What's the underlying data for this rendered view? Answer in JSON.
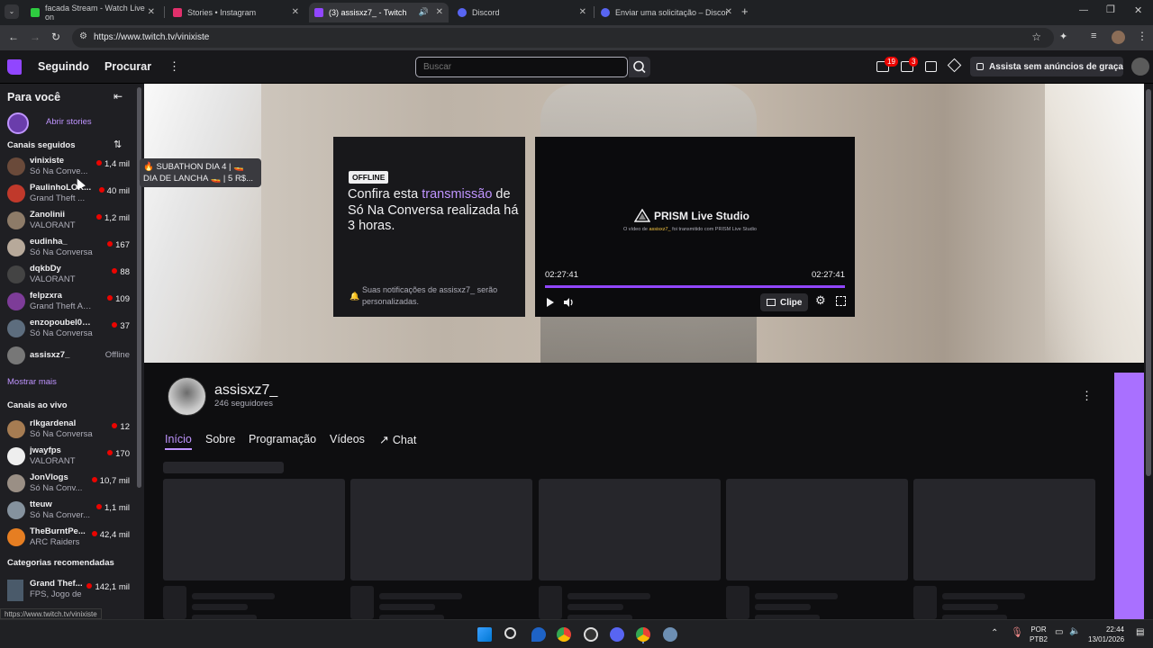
{
  "browser": {
    "tabs": [
      {
        "title": "facada Stream - Watch Live on",
        "color": "#2ecc40"
      },
      {
        "title": "Stories • Instagram",
        "color": "#e1306c"
      },
      {
        "title": "(3) assisxz7_ - Twitch",
        "color": "#9146ff"
      },
      {
        "title": "Discord",
        "color": "#5865f2"
      },
      {
        "title": "Enviar uma solicitação – Discor",
        "color": "#5865f2"
      }
    ],
    "url": "https://www.twitch.tv/vinixiste",
    "status_url": "https://www.twitch.tv/vinixiste"
  },
  "nav": {
    "following": "Seguindo",
    "browse": "Procurar",
    "search_placeholder": "Buscar",
    "notif_badge_1": "19",
    "notif_badge_2": "3",
    "ad_free": "Assista sem anúncios de graça"
  },
  "sidebar": {
    "for_you": "Para você",
    "open_stories": "Abrir stories",
    "followed_title": "Canais seguidos",
    "followed": [
      {
        "name": "vinixiste",
        "game": "Só Na Conve...",
        "viewers": "1,4 mil",
        "color": "#6a4a3a"
      },
      {
        "name": "PaulinhoLOK...",
        "game": "Grand Theft ...",
        "viewers": "40 mil",
        "color": "#c0392b"
      },
      {
        "name": "Zanolinii",
        "game": "VALORANT",
        "viewers": "1,2 mil",
        "color": "#8d7b68"
      },
      {
        "name": "eudinha_",
        "game": "Só Na Conversa",
        "viewers": "167",
        "color": "#b7a99a"
      },
      {
        "name": "dqkbDy",
        "game": "VALORANT",
        "viewers": "88",
        "color": "#444"
      },
      {
        "name": "felpzxra",
        "game": "Grand Theft Au...",
        "viewers": "109",
        "color": "#7d3c98"
      },
      {
        "name": "enzopoubel01 +1",
        "game": "Só Na Conversa",
        "viewers": "37",
        "color": "#5d6d7e"
      },
      {
        "name": "assisxz7_",
        "game": "",
        "viewers": "Offline",
        "color": "#777"
      }
    ],
    "show_more": "Mostrar mais",
    "live_title": "Canais ao vivo",
    "live": [
      {
        "name": "rlkgardenal",
        "game": "Só Na Conversa",
        "viewers": "12",
        "color": "#a67c52"
      },
      {
        "name": "jwayfps",
        "game": "VALORANT",
        "viewers": "170",
        "color": "#eee"
      },
      {
        "name": "JonVlogs",
        "game": "Só Na Conv...",
        "viewers": "10,7 mil",
        "color": "#9a8f85"
      },
      {
        "name": "tteuw",
        "game": "Só Na Conver...",
        "viewers": "1,1 mil",
        "color": "#85929e"
      },
      {
        "name": "TheBurntPe...",
        "game": "ARC Raiders",
        "viewers": "42,4 mil",
        "color": "#e67e22"
      }
    ],
    "categories_title": "Categorias recomendadas",
    "category": {
      "name": "Grand Thef...",
      "tags": "FPS, Jogo de",
      "viewers": "142,1 mil"
    }
  },
  "tooltip": {
    "line1": "SUBATHON DIA 4 | 🚤",
    "line2": "DIA DE LANCHA 🚤 | 5 R$..."
  },
  "offline_card": {
    "badge": "OFFLINE",
    "text_pre": "Confira esta ",
    "text_link": "transmissão",
    "text_post": " de Só Na Conversa realizada há 3 horas.",
    "notice": "Suas notificações de assisxz7_ serão personalizadas."
  },
  "player": {
    "brand": "PRISM Live Studio",
    "sub_pre": "O vídeo de ",
    "sub_user": "assisxz7_",
    "sub_post": " foi transmitido com PRISM Live Studio",
    "time_current": "02:27:41",
    "time_total": "02:27:41",
    "progress": 1.0,
    "clip": "Clipe"
  },
  "channel": {
    "name": "assisxz7_",
    "followers": "246 seguidores",
    "tabs": [
      "Início",
      "Sobre",
      "Programação",
      "Vídeos",
      "Chat"
    ],
    "accent": "#bf94ff"
  },
  "taskbar": {
    "lang1": "POR",
    "lang2": "PTB2",
    "time": "22:44",
    "date": "13/01/2026"
  }
}
